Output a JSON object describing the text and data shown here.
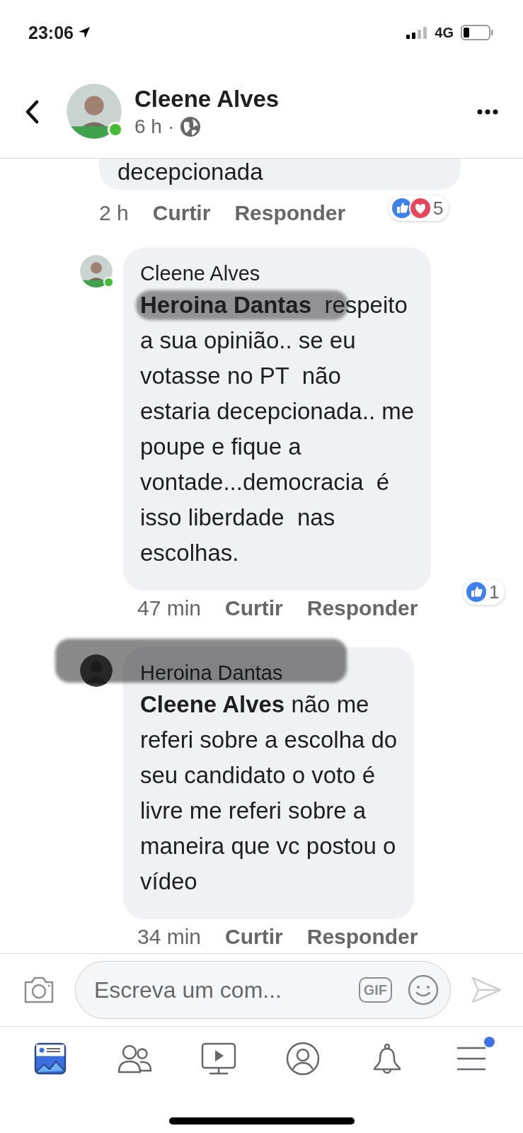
{
  "status_bar": {
    "time": "23:06",
    "network": "4G"
  },
  "header": {
    "name": "Cleene Alves",
    "time": "6 h",
    "separator": "·",
    "online": true
  },
  "comments": [
    {
      "kind": "partial",
      "text": "decepcionada",
      "time": "2 h",
      "like": "Curtir",
      "reply": "Responder",
      "reactions": {
        "like": true,
        "love": true,
        "count": "5"
      }
    },
    {
      "kind": "full",
      "author": "Cleene Alves",
      "online": true,
      "text": "**Heroina Dantas**  respeito\na sua opinião.. se eu\nvotasse no PT  não\nestaria decepcionada.. me\npoupe e fique a\nvontade...democracia  é\nisso liberdade  nas\nescolhas.",
      "time": "47 min",
      "like": "Curtir",
      "reply": "Responder",
      "reactions": {
        "like": true,
        "love": false,
        "count": "1"
      },
      "redacted": false,
      "mention_redacted": true
    },
    {
      "kind": "full",
      "author": "Heroina Dantas",
      "online": false,
      "text": "**Cleene Alves** não me\nreferi sobre a escolha do\nseu candidato o voto é\nlivre me referi sobre a\nmaneira que vc postou o\nvídeo",
      "time": "34 min",
      "like": "Curtir",
      "reply": "Responder",
      "redacted": true,
      "mention_redacted": false
    }
  ],
  "composer": {
    "placeholder": "Escreva um com...",
    "gif": "GIF"
  },
  "tab_bar": [
    {
      "kind": "feed",
      "selected": true,
      "badge": false
    },
    {
      "kind": "friends",
      "selected": false,
      "badge": false
    },
    {
      "kind": "video",
      "selected": false,
      "badge": false
    },
    {
      "kind": "profile",
      "selected": false,
      "badge": false
    },
    {
      "kind": "bell",
      "selected": false,
      "badge": false
    },
    {
      "kind": "menu",
      "selected": false,
      "badge": true
    }
  ]
}
